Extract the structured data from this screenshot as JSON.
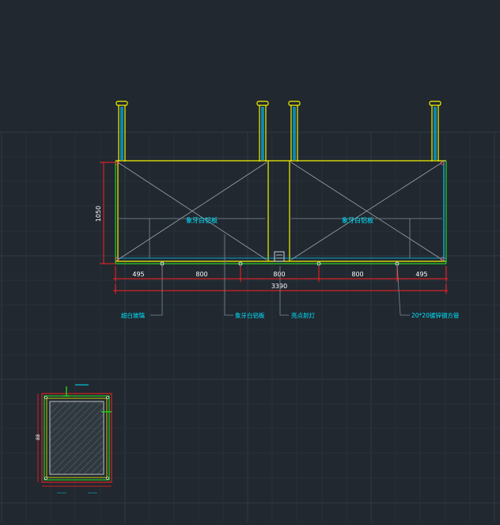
{
  "colors": {
    "background": "#212830",
    "grid": "#2f3a44",
    "frame": "#f2f200",
    "dimension": "#ff2020",
    "dim_text": "#ffffff",
    "annotation": "#00e5ff",
    "leader": "#7f8c99",
    "glass": "#00c8ff",
    "diagonal": "#9aa3ad",
    "green": "#22cc22"
  },
  "elevation": {
    "panel_labels": {
      "left": "象牙白铝板",
      "right": "象牙白铝板"
    },
    "height_dim": "1050",
    "segment_dims": [
      "495",
      "800",
      "800",
      "800",
      "495"
    ],
    "total_dim": "3390",
    "callouts": {
      "c1": "超白玻璃",
      "c2": "象牙白铝板",
      "c3": "亮点射灯",
      "c4": "20*20镀锌钢方管"
    }
  },
  "section": {
    "dim_left": "88",
    "dim_bottom_left": "——",
    "dim_bottom_right": "——"
  }
}
